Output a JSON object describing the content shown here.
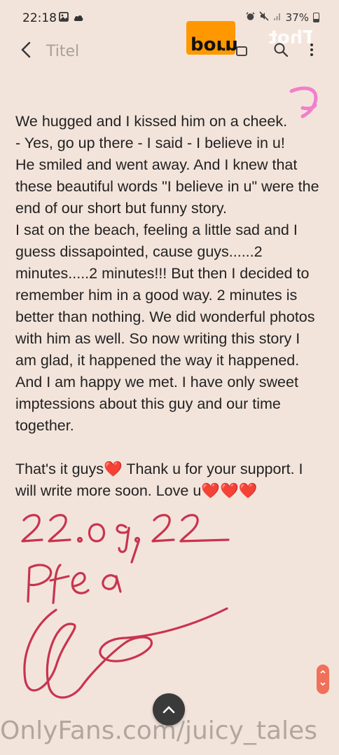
{
  "status_bar": {
    "time": "22:18",
    "battery": "37%",
    "battery_level": 0.37,
    "left_icons": [
      "image-icon",
      "cloud-icon"
    ],
    "right_icons": [
      "alarm-icon",
      "mute-icon",
      "signal-icon",
      "battery-icon"
    ]
  },
  "app_bar": {
    "title": "Titel",
    "back_icon": "chevron-left-icon",
    "actions": [
      "share-icon",
      "search-icon",
      "more-vertical-icon"
    ]
  },
  "logo": {
    "text": "porn Thot",
    "accent": "#ff9800"
  },
  "note": {
    "lines": [
      "We hugged and I kissed him on a cheek.",
      "- Yes, go up there - I said - I believe in u!",
      "He smiled and went away. And I knew that these beautiful words \"I believe in u\" were the end of our short but funny story.",
      "I sat on the beach, feeling a little sad and I guess dissapointed, cause guys......2 minutes.....2 minutes!!! But then I decided to remember him in a good way. 2 minutes is better than nothing. We did wonderful photos with him as well. So now writing this story I am glad, it happened the way it happened. And I am happy we met. I have only sweet imptessions about this guy and our time together."
    ],
    "closing": "That's it guys❤️ Thank u for your support. I will write more soon. Love u❤️❤️❤️"
  },
  "handwriting": {
    "date": "22.09.22",
    "name": "Pfea",
    "ink_color": "#c8344f"
  },
  "scroll_handle": {
    "icon": "scroll-handle-icon"
  },
  "fab": {
    "icon": "chevron-up-icon"
  },
  "watermark": {
    "text": "OnlyFans.com/juicy_tales"
  },
  "colors": {
    "background": "#f3e4db",
    "text": "#222222",
    "title": "#a9a09a",
    "accent_scroll": "#f0705a"
  }
}
